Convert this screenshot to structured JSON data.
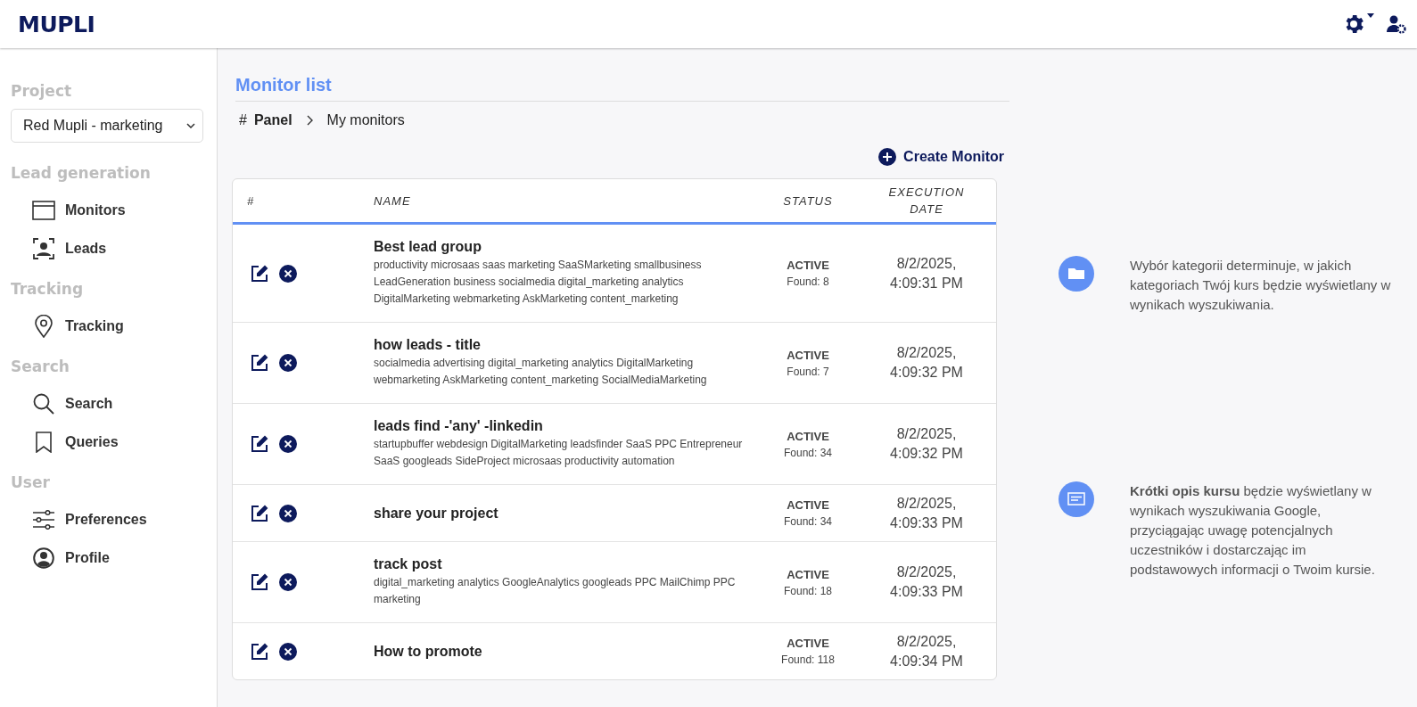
{
  "header": {
    "logo": "MUPLI"
  },
  "sidebar": {
    "project_label": "Project",
    "project_select": {
      "value": "Red Mupli - marketing"
    },
    "groups": [
      {
        "title": "Lead generation",
        "items": [
          {
            "label": "Monitors"
          },
          {
            "label": "Leads"
          }
        ]
      },
      {
        "title": "Tracking",
        "items": [
          {
            "label": "Tracking"
          }
        ]
      },
      {
        "title": "Search",
        "items": [
          {
            "label": "Search"
          },
          {
            "label": "Queries"
          }
        ]
      },
      {
        "title": "User",
        "items": [
          {
            "label": "Preferences"
          },
          {
            "label": "Profile"
          }
        ]
      }
    ]
  },
  "page": {
    "title": "Monitor list",
    "breadcrumb": {
      "hash": "#",
      "root": "Panel",
      "current": "My monitors"
    },
    "create_button": "Create Monitor"
  },
  "table": {
    "columns": [
      "#",
      "NAME",
      "STATUS",
      "EXECUTION DATE"
    ],
    "rows": [
      {
        "name": "Best lead group",
        "tags": "productivity microsaas saas marketing SaaSMarketing smallbusiness LeadGeneration business socialmedia digital_marketing analytics DigitalMarketing webmarketing AskMarketing content_marketing",
        "status": "ACTIVE",
        "found": "Found: 8",
        "date": "8/2/2025, 4:09:31 PM"
      },
      {
        "name": "how leads - title",
        "tags": "socialmedia advertising digital_marketing analytics DigitalMarketing webmarketing AskMarketing content_marketing SocialMediaMarketing",
        "status": "ACTIVE",
        "found": "Found: 7",
        "date": "8/2/2025, 4:09:32 PM"
      },
      {
        "name": "leads find -'any' -linkedin",
        "tags": "startupbuffer webdesign DigitalMarketing leadsfinder SaaS PPC Entrepreneur SaaS googleads SideProject microsaas productivity automation",
        "status": "ACTIVE",
        "found": "Found: 34",
        "date": "8/2/2025, 4:09:32 PM"
      },
      {
        "name": "share your project",
        "status": "ACTIVE",
        "found": "Found: 34",
        "date": "8/2/2025, 4:09:33 PM"
      },
      {
        "name": "track post",
        "tags": "digital_marketing analytics GoogleAnalytics googleads PPC MailChimp PPC marketing",
        "status": "ACTIVE",
        "found": "Found: 18",
        "date": "8/2/2025, 4:09:33 PM"
      },
      {
        "name": "How to promote",
        "status": "ACTIVE",
        "found": "Found: 118",
        "date": "8/2/2025, 4:09:34 PM"
      }
    ]
  },
  "info": [
    {
      "text": "Wybór kategorii determinuje, w jakich kategoriach Twój kurs będzie wyświetlany w wynikach wyszukiwania."
    },
    {
      "text": "**Krótki opis kursu**  będzie wyświetlany w wynikach wyszukiwania Google, przyciągając uwagę potencjalnych uczestników i dostarczając im podstawowych informacji o Twoim kursie."
    }
  ]
}
